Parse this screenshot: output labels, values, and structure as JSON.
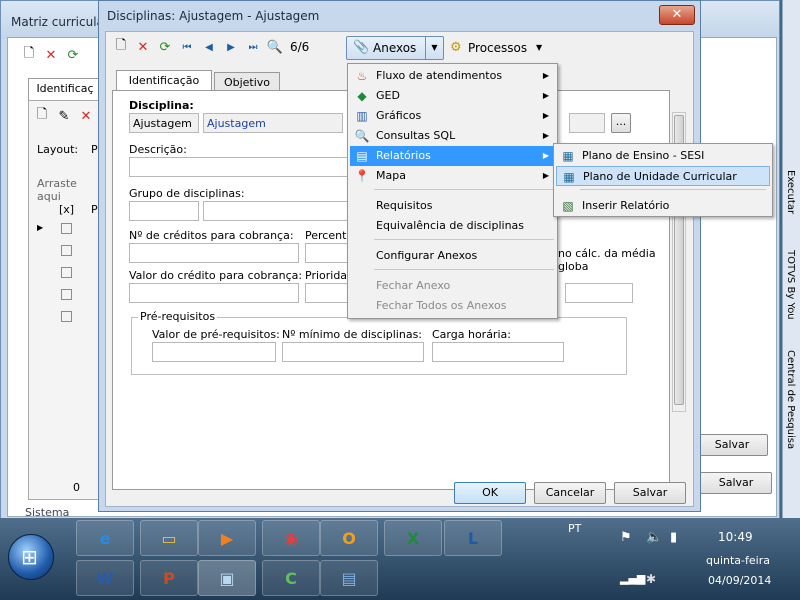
{
  "background_window": {
    "title": "Matriz curricula",
    "tab_label": "Identificaç",
    "layout_label": "Layout:",
    "layout_value": "P",
    "drag_hint": "Arraste aqui",
    "grid_header_check": "[x]",
    "grid_header_p": "P",
    "count": "0",
    "save_label": "Salvar",
    "status_text": "Sistema"
  },
  "dialog": {
    "title": "Disciplinas: Ajustagem - Ajustagem",
    "close_glyph": "✕",
    "toolbar": {
      "record_counter": "6/6",
      "anexos_label": "Anexos",
      "processos_label": "Processos"
    },
    "tabs": [
      "Identificação",
      "Objetivo"
    ],
    "fields": {
      "disciplina_label": "Disciplina:",
      "disciplina_code": "Ajustagem",
      "disciplina_name": "Ajustagem",
      "descricao_label": "Descrição:",
      "grupo_label": "Grupo de disciplinas:",
      "creditos_label": "Nº de créditos para cobrança:",
      "percentual_label": "Percentu",
      "valor_credito_label": "Valor do crédito para cobrança:",
      "prioridade_label": "Prioridade",
      "media_text": "no cálc. da média globa",
      "prereq_group_label": "Pré-requisitos",
      "valor_prereq_label": "Valor de pré-requisitos:",
      "min_disc_label": "Nº mínimo de disciplinas:",
      "carga_label": "Carga horária:",
      "ellipsis": "..."
    },
    "buttons": {
      "ok": "OK",
      "cancel": "Cancelar",
      "save": "Salvar"
    }
  },
  "anexos_menu": {
    "items": [
      {
        "label": "Fluxo de atendimentos",
        "icon": "flow-icon",
        "submenu": true
      },
      {
        "label": "GED",
        "icon": "ged-icon",
        "submenu": true
      },
      {
        "label": "Gráficos",
        "icon": "chart-icon",
        "submenu": true
      },
      {
        "label": "Consultas SQL",
        "icon": "query-icon",
        "submenu": true
      },
      {
        "label": "Relatórios",
        "icon": "report-icon",
        "submenu": true,
        "selected": true
      },
      {
        "label": "Mapa",
        "icon": "map-pin-icon",
        "submenu": true
      },
      {
        "label": "Requisitos"
      },
      {
        "label": "Equivalência de disciplinas"
      },
      {
        "label": "Configurar Anexos"
      },
      {
        "label": "Fechar Anexo",
        "disabled": true
      },
      {
        "label": "Fechar Todos os Anexos",
        "disabled": true
      }
    ]
  },
  "relatorios_submenu": {
    "items": [
      {
        "label": "Plano de Ensino - SESI"
      },
      {
        "label": "Plano de Unidade Curricular",
        "highlighted": true
      },
      {
        "label": "Inserir Relatório"
      }
    ]
  },
  "right_edge_text": [
    "Executar",
    "TOTVS By You",
    "Central de Pesquisa"
  ],
  "taskbar": {
    "language": "PT",
    "time": "10:49",
    "day": "quinta-feira",
    "date": "04/09/2014"
  },
  "colors": {
    "menu_selected": "#3399ff",
    "submenu_highlight": "#cfe3f8",
    "dialog_frame": "#c7d8ec",
    "taskbar": "#2b4863"
  }
}
